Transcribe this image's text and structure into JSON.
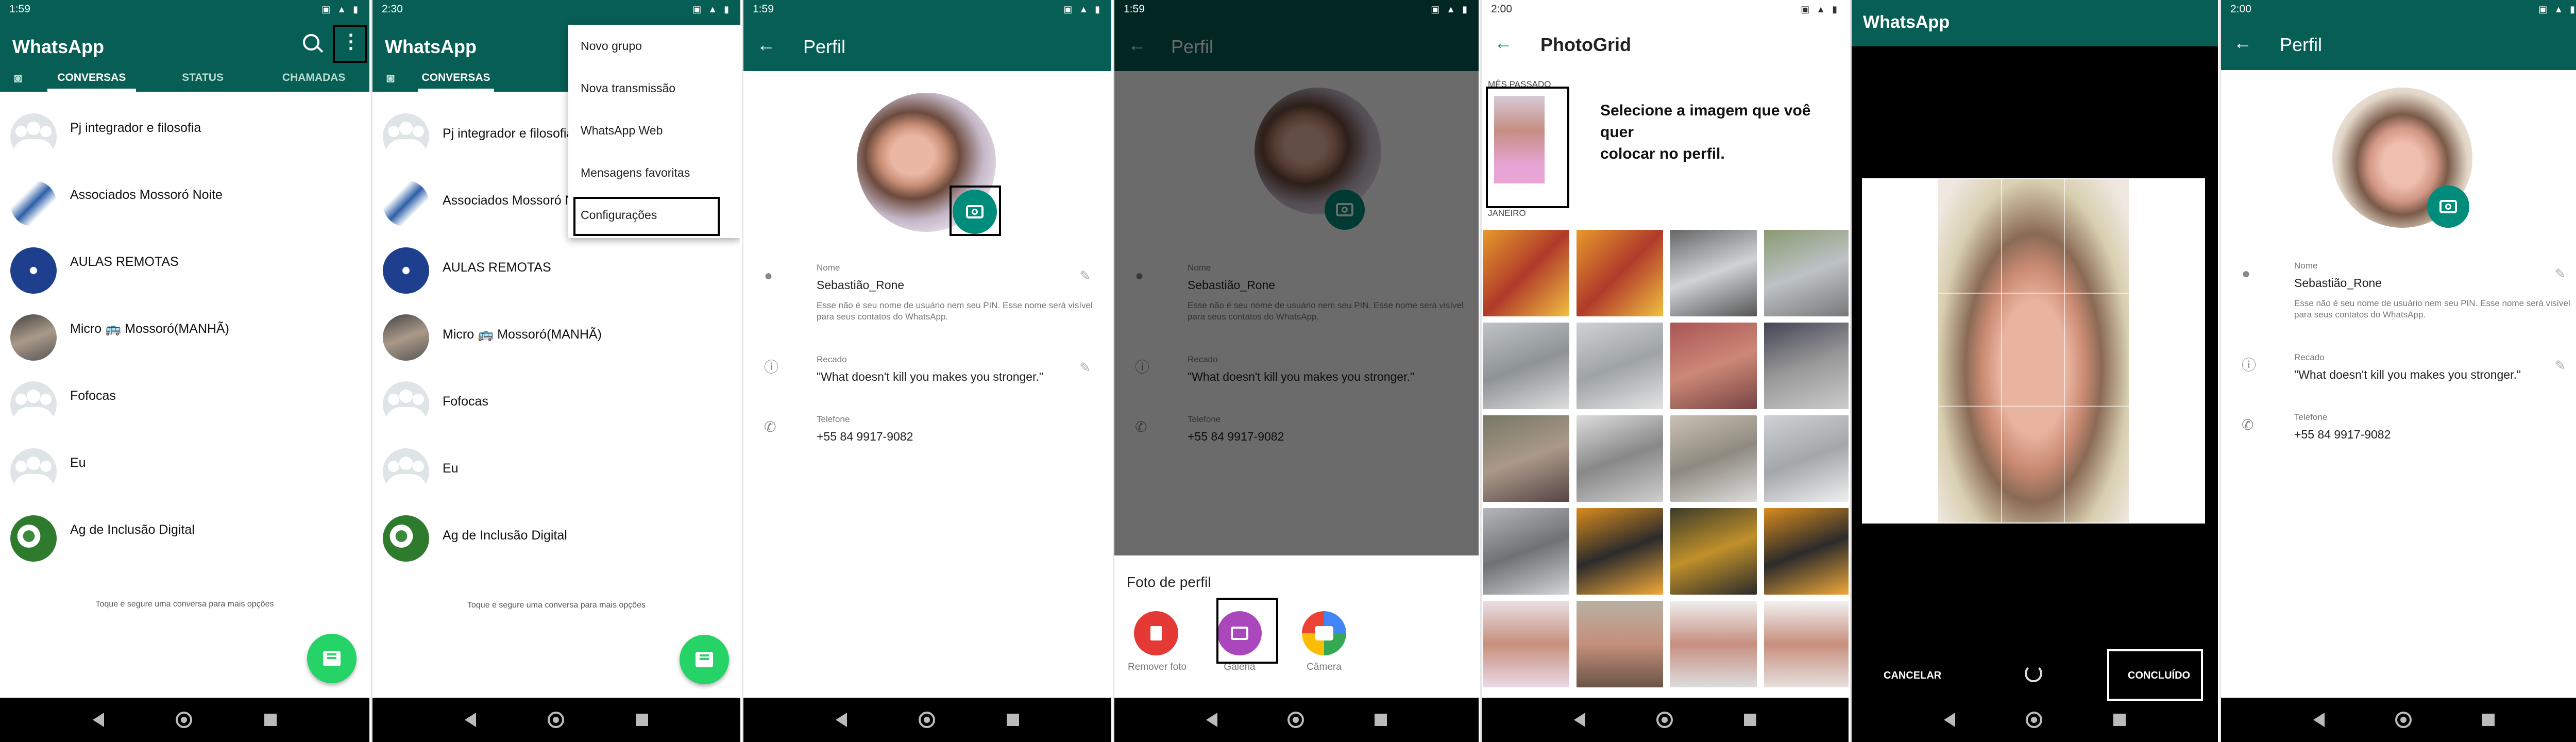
{
  "colors": {
    "teal": "#075e54",
    "teal_dark": "#054d44",
    "accent": "#25d366",
    "fab_green": "#008c7b",
    "red": "#e53935",
    "purple": "#ab47bc"
  },
  "s1": {
    "status": {
      "time": "1:59",
      "icons": "▣ ▲ ▮"
    },
    "title": "WhatsApp",
    "search_icon": "🔍",
    "more_icon": "⋮",
    "tabs": [
      "CONVERSAS",
      "STATUS",
      "CHAMADAS"
    ],
    "chats": [
      "Pj integrador e filosofia",
      "Associados Mossoró Noite",
      "AULAS REMOTAS",
      "Micro 🚌 Mossoró(MANHÃ)",
      "Fofocas",
      "Eu",
      "Ag de Inclusão Digital"
    ],
    "hint": "Toque e segure uma conversa para mais opções"
  },
  "s2": {
    "status": {
      "time": "2:30",
      "icons": "▣ ▲ ▮"
    },
    "title": "WhatsApp",
    "tab_partial": "CONVERSAS",
    "chats": [
      "Pj integrador e filosofia",
      "Associados Mossoró Noite",
      "AULAS REMOTAS",
      "Micro 🚌 Mossoró(MANHÃ)",
      "Fofocas",
      "Eu",
      "Ag de Inclusão Digital"
    ],
    "menu": [
      "Novo grupo",
      "Nova transmissão",
      "WhatsApp Web",
      "Mensagens favoritas",
      "Configurações"
    ],
    "hint": "Toque e segure uma conversa para mais opções"
  },
  "profile": {
    "title": "Perfil",
    "name_label": "Nome",
    "name": "Sebastião_Rone",
    "name_desc": "Esse não é seu nome de usuário nem seu PIN. Esse nome será visível para seus contatos do WhatsApp.",
    "about_label": "Recado",
    "about": "\"What doesn't kill you makes you stronger.\"",
    "phone_label": "Telefone",
    "phone": "+55 84 9917-9082"
  },
  "s3": {
    "status": {
      "time": "1:59",
      "icons": "▣ ▲ ▮"
    }
  },
  "s4": {
    "status": {
      "time": "1:59",
      "icons": "▣ ▲ ▮"
    },
    "sheet_title": "Foto de perfil",
    "options": [
      "Remover foto",
      "Galeria",
      "Câmera"
    ]
  },
  "s5": {
    "status": {
      "time": "2:00",
      "icons": "▣ ▲ ▮"
    },
    "title": "PhotoGrid",
    "section1": "MÊS PASSADO",
    "section2": "JANEIRO",
    "caption": [
      "Selecione a imagem que voê",
      "quer",
      "colocar no perfil."
    ]
  },
  "s6": {
    "status": {
      "time": "",
      "icons": ""
    },
    "title": "WhatsApp",
    "cancel": "CANCELAR",
    "done": "CONCLUÍDO"
  },
  "s7": {
    "status": {
      "time": "2:00",
      "icons": "▣ ▲ ▮"
    }
  }
}
